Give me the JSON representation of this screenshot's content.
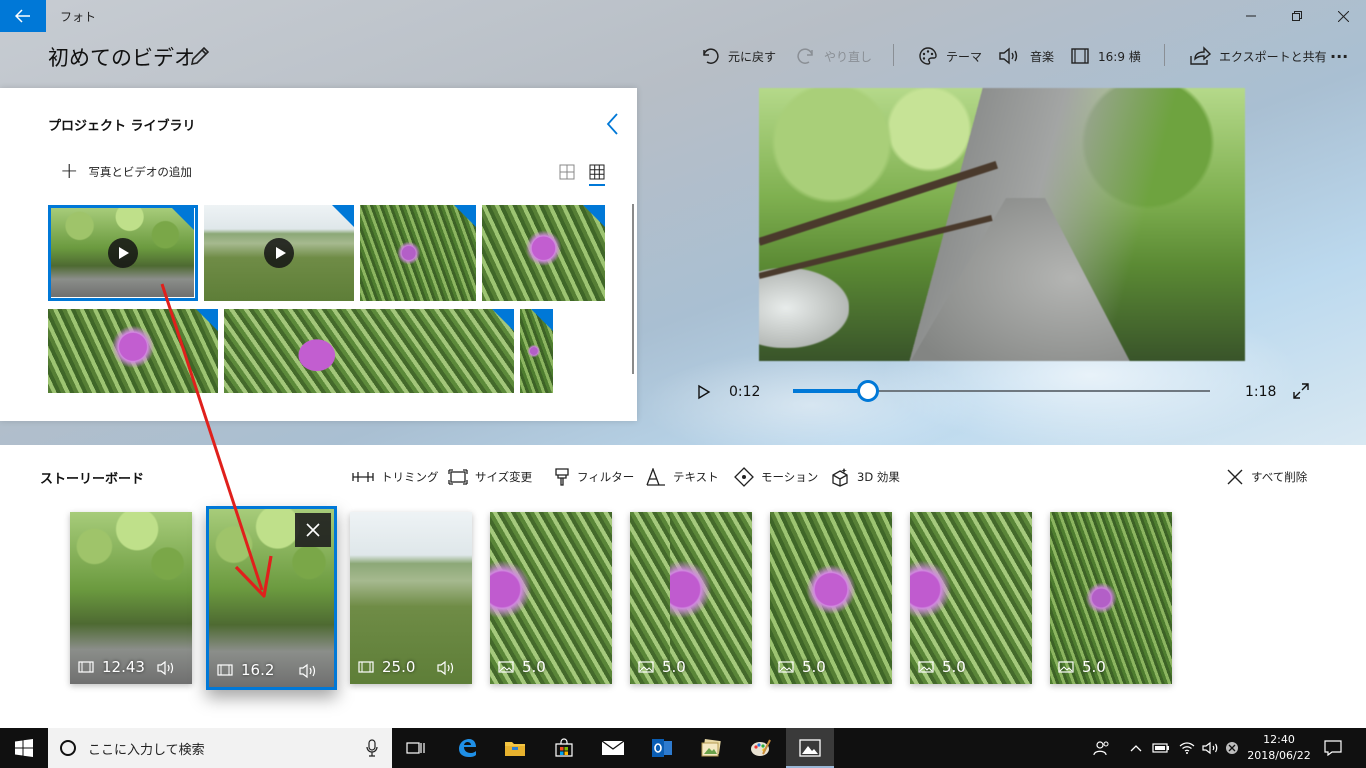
{
  "window": {
    "app_name": "フォト",
    "project_title": "初めてのビデオ"
  },
  "toolbar": {
    "undo": "元に戻す",
    "redo": "やり直し",
    "theme": "テーマ",
    "music": "音楽",
    "aspect": "16:9 横",
    "export": "エクスポートと共有",
    "more": "···"
  },
  "library": {
    "title": "プロジェクト ライブラリ",
    "add_label": "写真とビデオの追加"
  },
  "player": {
    "current_time": "0:12",
    "duration": "1:18",
    "progress": 0.18
  },
  "storyboard": {
    "title": "ストーリーボード",
    "tools": {
      "trim": "トリミング",
      "resize": "サイズ変更",
      "filter": "フィルター",
      "text": "テキスト",
      "motion": "モーション",
      "effects3d": "3D 効果"
    },
    "delete_all": "すべて削除",
    "clips": [
      {
        "kind": "video",
        "duration": "12.43",
        "audio": true
      },
      {
        "kind": "video",
        "duration": "16.2",
        "audio": true,
        "selected": true
      },
      {
        "kind": "video",
        "duration": "25.0",
        "audio": true
      },
      {
        "kind": "photo",
        "duration": "5.0"
      },
      {
        "kind": "photo",
        "duration": "5.0"
      },
      {
        "kind": "photo",
        "duration": "5.0"
      },
      {
        "kind": "photo",
        "duration": "5.0"
      },
      {
        "kind": "photo",
        "duration": "5.0"
      }
    ]
  },
  "taskbar": {
    "search_placeholder": "ここに入力して検索",
    "time": "12:40",
    "date": "2018/06/22"
  },
  "colors": {
    "accent": "#0078d7",
    "annotation_arrow": "#e0201c"
  }
}
